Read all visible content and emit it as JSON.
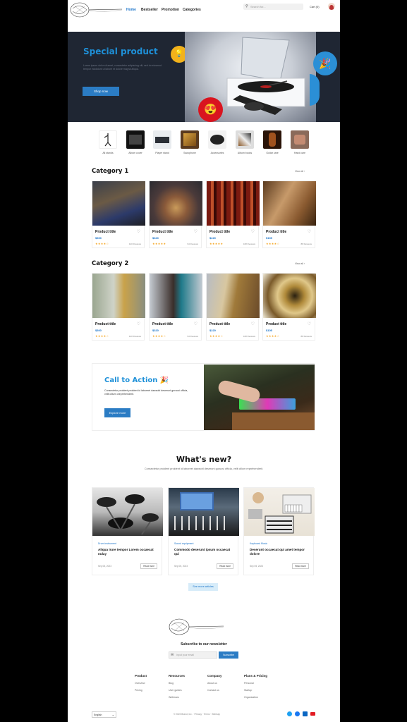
{
  "header": {
    "logo_alt": "Music logo",
    "nav": [
      "Home",
      "Bestseller",
      "Promotion",
      "Categories"
    ],
    "search_placeholder": "Search for...",
    "cart_label": "Cart (0)"
  },
  "hero": {
    "title": "Special product",
    "text": "Lorem ipsum dolor sit amet, consectetur adipiscing elit, sed do eiusmod tempor incididunt ut labore et dolore magna aliqua.",
    "button": "Shop now"
  },
  "categories": [
    "All stands",
    "Album cover",
    "Player stand",
    "Saxophone",
    "Accessories",
    "Album books",
    "Guitar care",
    "Hand care"
  ],
  "category1": {
    "title": "Category 1",
    "view_all": "View all ›",
    "products": [
      {
        "title": "Product title",
        "price": "$300",
        "stars": "★★★★☆",
        "reviews": "120 Reviews"
      },
      {
        "title": "Product title",
        "price": "$320",
        "stars": "★★★★★",
        "reviews": "94 Reviews"
      },
      {
        "title": "Product title",
        "price": "$220",
        "stars": "★★★★★",
        "reviews": "168 Reviews"
      },
      {
        "title": "Product title",
        "price": "$105",
        "stars": "★★★★☆",
        "reviews": "88 Reviews"
      }
    ]
  },
  "category2": {
    "title": "Category 2",
    "view_all": "View all ›",
    "products": [
      {
        "title": "Product title",
        "price": "$300",
        "stars": "★★★★☆",
        "reviews": "120 Reviews"
      },
      {
        "title": "Product title",
        "price": "$320",
        "stars": "★★★★☆",
        "reviews": "94 Reviews"
      },
      {
        "title": "Product title",
        "price": "$220",
        "stars": "★★★★☆",
        "reviews": "168 Reviews"
      },
      {
        "title": "Product title",
        "price": "$105",
        "stars": "★★★★☆",
        "reviews": "88 Reviews"
      }
    ]
  },
  "cta": {
    "title": "Call to Action 🎉",
    "text": "Consectetur proident proident id laboreet dawsohl deserunt gurucsi officia, velit cillum oreprehenderit.",
    "button": "Explore more"
  },
  "whats_new": {
    "title": "What's new?",
    "subtitle": "Consectetur proident proident id laboreet dawsohl deserunt gurucsi officia, velit cillum reprehenderit.",
    "articles": [
      {
        "tag": "Drum instrument",
        "title": "Aliqua irure tempor Lorem occaecat nulay",
        "date": "Sep 05, 2023",
        "read": "Read more"
      },
      {
        "tag": "Sound equipment",
        "title": "Commodo deserunt ipsum occaecat qui",
        "date": "Sep 05, 2023",
        "read": "Read more"
      },
      {
        "tag": "Keyboard Music",
        "title": "Deserunt occaecat qui amet tempor dolore",
        "date": "Sep 05, 2023",
        "read": "Read more"
      }
    ],
    "see_more": "See more articles"
  },
  "footer": {
    "newsletter_title": "Subscribe to our newsletter",
    "email_placeholder": "Input your email",
    "subscribe_btn": "Subscribe",
    "columns": [
      {
        "title": "Product",
        "links": [
          "Overview",
          "Pricing"
        ]
      },
      {
        "title": "Resources",
        "links": [
          "Blog",
          "User guides",
          "Webinars"
        ]
      },
      {
        "title": "Company",
        "links": [
          "About us",
          "Contact us"
        ]
      },
      {
        "title": "Plans & Pricing",
        "links": [
          "Personal",
          "Startup",
          "Organization"
        ]
      }
    ],
    "language": "English",
    "copyright": "© 2023 Brand, Inc. · Privacy · Terms · Sitemap"
  },
  "colors": {
    "accent": "#2b7cc4",
    "hero_bg": "#1f2633",
    "title_blue": "#1e90d8"
  }
}
